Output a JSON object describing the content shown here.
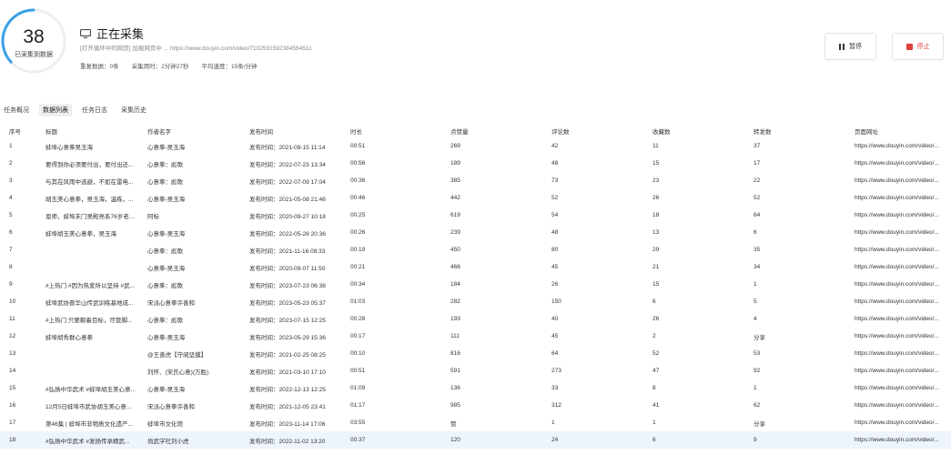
{
  "gauge": {
    "count": "38",
    "label": "已采集到数据",
    "progress": 0.37,
    "accent": "#3aa0e8"
  },
  "status": {
    "title": "正在采集",
    "url": "[打开循环中的网页] 加载网页中 ... https://www.douyin.com/video/7102591592384564511",
    "duplicates": "重复数据：0条",
    "elapsed": "采集用时：2分钟27秒",
    "speed": "平均速度：15条/分钟"
  },
  "buttons": {
    "pause": "暂停",
    "stop": "停止"
  },
  "tabs": [
    {
      "label": "任务概况",
      "active": false
    },
    {
      "label": "数据列表",
      "active": true
    },
    {
      "label": "任务日志",
      "active": false
    },
    {
      "label": "采集历史",
      "active": false
    }
  ],
  "table": {
    "headers": [
      "序号",
      "标题",
      "作者名字",
      "发布时间",
      "时长",
      "点赞量",
      "评论数",
      "收藏数",
      "转发数",
      "页面网址"
    ],
    "rows": [
      [
        "1",
        "蚌埠心意拳吴玉海",
        "心意拳-吴玉海",
        "发布时间：2021-09-15 11:14",
        "00:51",
        "269",
        "42",
        "11",
        "37",
        "https://www.douyin.com/video/..."
      ],
      [
        "2",
        "要得到你必须要付出，要付出还...",
        "心意拳：彪歌",
        "发布时间：2022-07-23 13:34",
        "00:56",
        "189",
        "48",
        "15",
        "17",
        "https://www.douyin.com/video/..."
      ],
      [
        "3",
        "与其在风雨中逃避，不如在雷电...",
        "心意拳：彪歌",
        "发布时间：2022-07-09 17:04",
        "00:36",
        "385",
        "73",
        "23",
        "22",
        "https://www.douyin.com/video/..."
      ],
      [
        "4",
        "胡玉美心意拳，吴玉海，温练，...",
        "心意拳-吴玉海",
        "发布时间：2021-05-08 21:46",
        "00:46",
        "442",
        "52",
        "26",
        "52",
        "https://www.douyin.com/video/..."
      ],
      [
        "5",
        "恩师，蚌埠末门吴殿亮系76岁老...",
        "阿标",
        "发布时间：2020-09-27 10:18",
        "00:25",
        "619",
        "54",
        "18",
        "64",
        "https://www.douyin.com/video/..."
      ],
      [
        "6",
        "蚌埠胡玉美心意拳，吴玉海",
        "心意拳-吴玉海",
        "发布时间：2022-05-28 20:36",
        "00:26",
        "239",
        "48",
        "13",
        "6",
        "https://www.douyin.com/video/..."
      ],
      [
        "7",
        "",
        "心意拳：彪歌",
        "发布时间：2021-11-16 08:33",
        "00:19",
        "450",
        "80",
        "29",
        "35",
        "https://www.douyin.com/video/..."
      ],
      [
        "8",
        "",
        "心意拳-吴玉海",
        "发布时间：2020-09-07 11:50",
        "00:21",
        "466",
        "45",
        "21",
        "34",
        "https://www.douyin.com/video/..."
      ],
      [
        "9",
        "#上热门 #因为热爱所以坚持 #武...",
        "心意拳：彪歌",
        "发布时间：2023-07-23 06:38",
        "00:34",
        "184",
        "26",
        "15",
        "1",
        "https://www.douyin.com/video/..."
      ],
      [
        "10",
        "蚌埠武协晋华山传武训练基地成...",
        "宋派心意拳许善和",
        "发布时间：2023-05-23 05:37",
        "01:03",
        "282",
        "150",
        "6",
        "5",
        "https://www.douyin.com/video/..."
      ],
      [
        "11",
        "#上热门 只要朝着目标，尽管脚...",
        "心意拳：彪歌",
        "发布时间：2023-07-15 12:25",
        "00:28",
        "193",
        "40",
        "26",
        "4",
        "https://www.douyin.com/video/..."
      ],
      [
        "12",
        "蚌埠胡秀群心意拳",
        "心意拳-吴玉海",
        "发布时间：2023-05-29 15:36",
        "00:17",
        "111",
        "45",
        "2",
        "分享",
        "https://www.douyin.com/video/..."
      ],
      [
        "13",
        "",
        "@王善虎【守阅坚摸】",
        "发布时间：2021-02-25 08:25",
        "00:10",
        "816",
        "64",
        "52",
        "53",
        "https://www.douyin.com/video/..."
      ],
      [
        "14",
        "",
        "刘怀、(宋氏心意)(万胜)",
        "发布时间：2021-03-10 17:10",
        "00:51",
        "591",
        "273",
        "47",
        "92",
        "https://www.douyin.com/video/..."
      ],
      [
        "15",
        "#弘扬中华武术 #蚌埠胡玉美心意...",
        "心意拳-吴玉海",
        "发布时间：2022-12-13 12:25",
        "01:09",
        "136",
        "33",
        "8",
        "1",
        "https://www.douyin.com/video/..."
      ],
      [
        "16",
        "12月5日蚌埠市武协胡玉美心意...",
        "宋派心意拳许善和",
        "发布时间：2021-12-05 23:41",
        "01:17",
        "985",
        "312",
        "41",
        "62",
        "https://www.douyin.com/video/..."
      ],
      [
        "17",
        "第46集 | 蚌埠市非物质文化遗产...",
        "蚌埠市文化馆",
        "发布时间：2023-11-14 17:06",
        "03:55",
        "赞",
        "1",
        "1",
        "分享",
        "https://www.douyin.com/video/..."
      ],
      [
        "18",
        "#弘扬中华武术 #发扬传承精武...",
        "尚武学社刘小虎",
        "发布时间：2022-11-02 13:20",
        "00:37",
        "120",
        "24",
        "6",
        "9",
        "https://www.douyin.com/video/..."
      ]
    ],
    "highlighted_row": 18
  }
}
